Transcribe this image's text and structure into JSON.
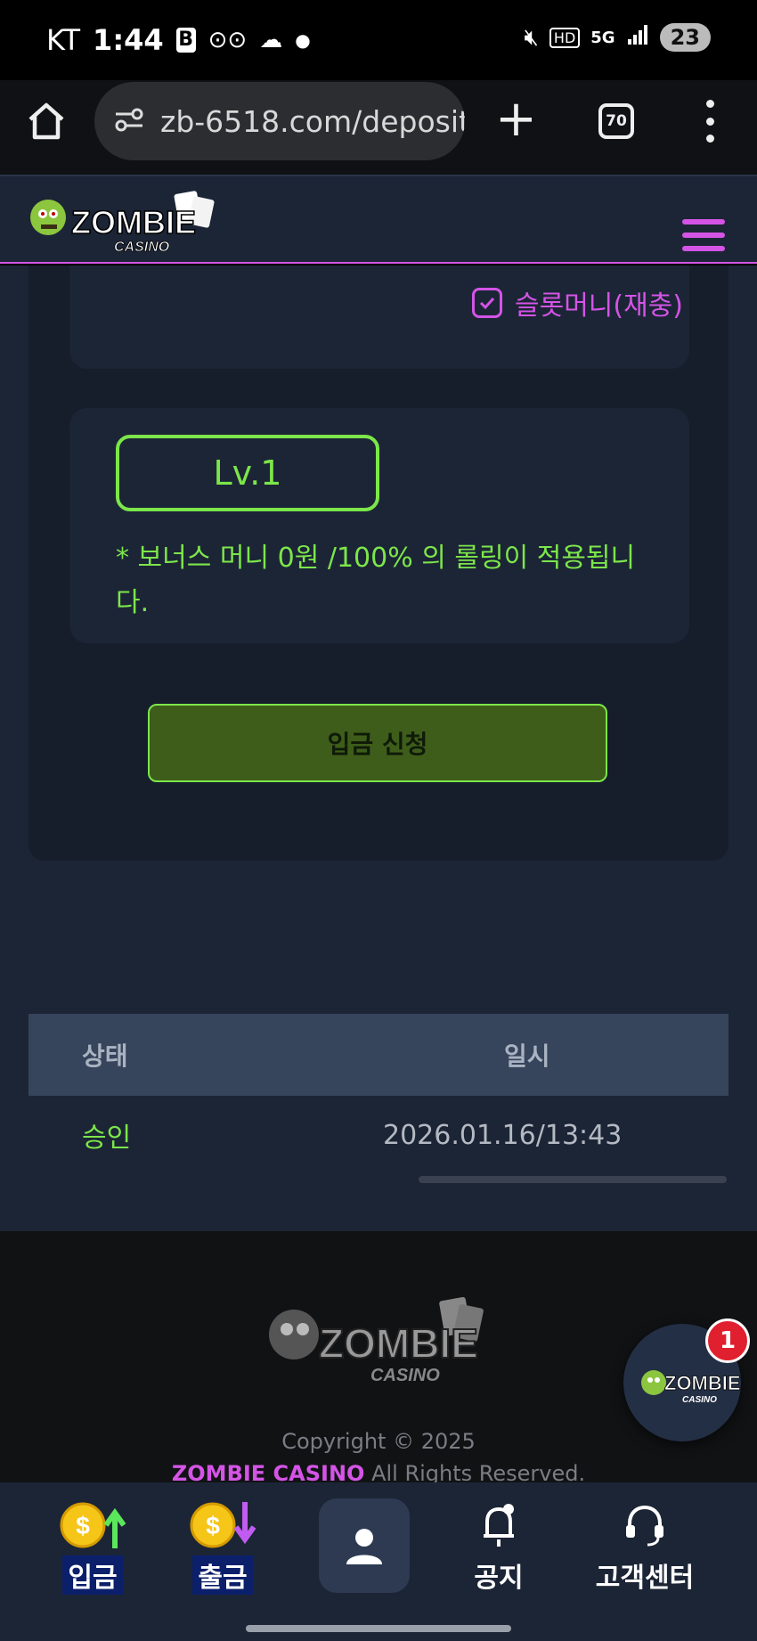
{
  "status_bar": {
    "carrier": "KT",
    "time": "1:44",
    "network_hd": "HD",
    "network_5g": "5G",
    "battery": "23"
  },
  "browser": {
    "url": "zb-6518.com/deposit",
    "tab_count": "70"
  },
  "site": {
    "logo_alt": "ZOMBIE CASINO",
    "accent_color": "#d454e6",
    "green_color": "#7ce64a"
  },
  "deposit": {
    "slot_checkbox_label": "슬롯머니(재충)",
    "slot_checked": true,
    "level_label": "Lv.1",
    "bonus_note": "* 보너스 머니 0원 /100% 의 롤링이 적용됩니다.",
    "submit_label": "입금 신청"
  },
  "history": {
    "headers": {
      "status": "상태",
      "date": "일시"
    },
    "rows": [
      {
        "status": "승인",
        "date": "2026.01.16/13:43"
      }
    ]
  },
  "footer": {
    "copyright": "Copyright © 2025",
    "brand": "ZOMBIE CASINO",
    "rights": " All Rights Reserved."
  },
  "chat_fab": {
    "badge_count": "1"
  },
  "bottom_nav": {
    "deposit": "입금",
    "withdraw": "출금",
    "notice": "공지",
    "support": "고객센터"
  }
}
